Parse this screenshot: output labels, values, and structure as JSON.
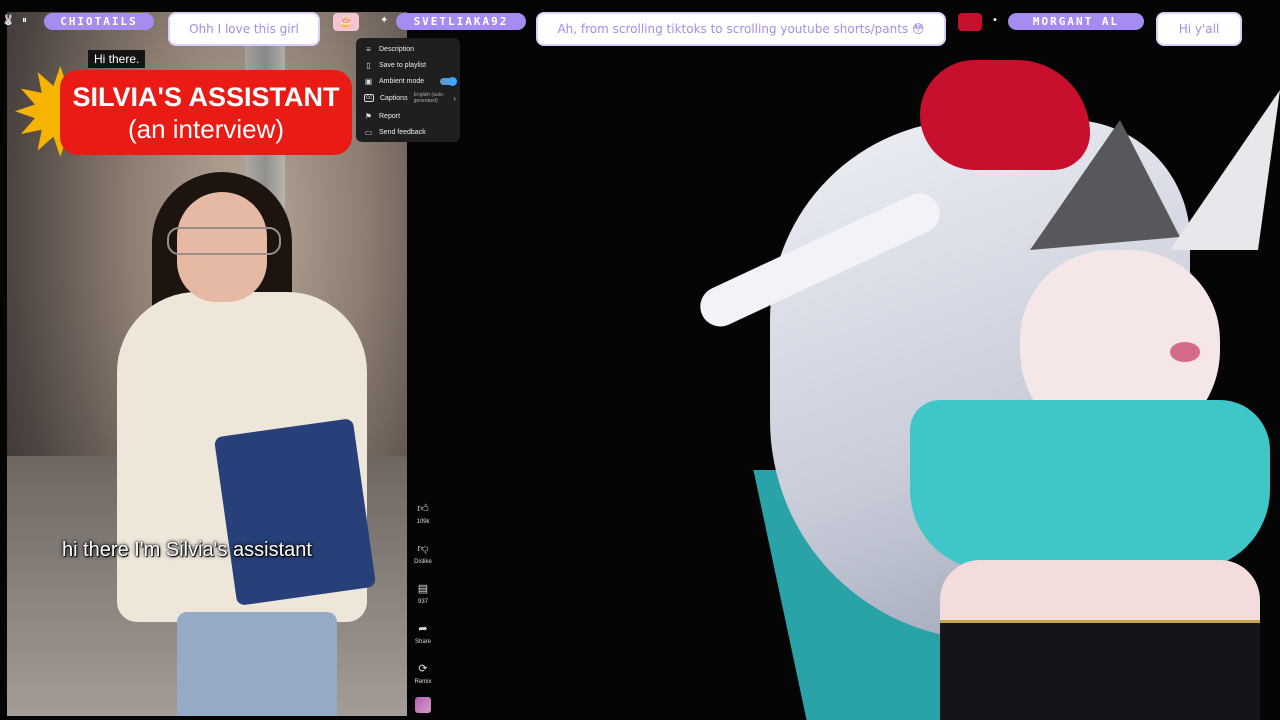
{
  "chat": {
    "messages": [
      {
        "user": "CHIOTAILS",
        "text": "Ohh I love this girl"
      },
      {
        "user": "SVETLIAKA92",
        "text": "Ah, from scrolling tiktoks to scrolling youtube shorts/pants 😳"
      },
      {
        "user": "MORGANT  AL",
        "text": "Hi y'all"
      }
    ]
  },
  "video": {
    "overlay_small": "Hi there.",
    "title_line1": "SILVIA'S ASSISTANT",
    "title_line2": "(an interview)",
    "caption": "hi there I'm Silvia's assistant"
  },
  "context_menu": {
    "items": [
      {
        "label": "Description",
        "icon": "description-icon"
      },
      {
        "label": "Save to playlist",
        "icon": "save-playlist-icon"
      },
      {
        "label": "Ambient mode",
        "icon": "ambient-mode-icon",
        "toggle": true
      },
      {
        "label": "Captions",
        "icon": "captions-icon",
        "sub": "English (auto-generated)"
      },
      {
        "label": "Report",
        "icon": "flag-icon"
      },
      {
        "label": "Send feedback",
        "icon": "feedback-icon"
      }
    ]
  },
  "actions": {
    "like_count": "109k",
    "dislike_label": "Dislike",
    "comment_count": "937",
    "share_label": "Share",
    "remix_label": "Remix"
  },
  "colors": {
    "name_pill": "#a68cf0",
    "bubble_text": "#a18ee8",
    "title_red": "#ea1a14",
    "toggle_on": "#3ea6ff"
  }
}
